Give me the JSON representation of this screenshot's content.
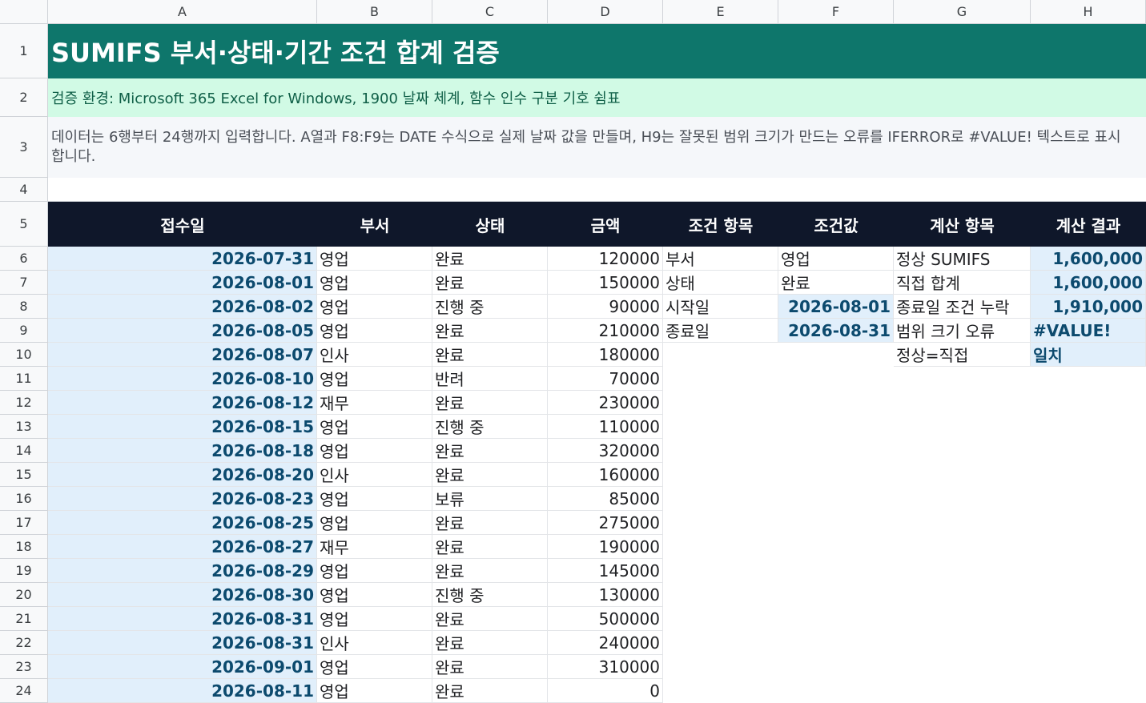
{
  "columns": [
    "A",
    "B",
    "C",
    "D",
    "E",
    "F",
    "G",
    "H"
  ],
  "rows": [
    "1",
    "2",
    "3",
    "4",
    "5",
    "6",
    "7",
    "8",
    "9",
    "10",
    "11",
    "12",
    "13",
    "14",
    "15",
    "16",
    "17",
    "18",
    "19",
    "20",
    "21",
    "22",
    "23",
    "24"
  ],
  "title": "SUMIFS 부서·상태·기간 조건 합계 검증",
  "environment": "검증 환경: Microsoft 365 Excel for Windows, 1900 날짜 체계, 함수 인수 구분 기호 쉼표",
  "description": "데이터는 6행부터 24행까지 입력합니다. A열과 F8:F9는 DATE 수식으로 실제 날짜 값을 만들며, H9는 잘못된 범위 크기가 만드는 오류를 IFERROR로 #VALUE! 텍스트로 표시합니다.",
  "headers": {
    "a": "접수일",
    "b": "부서",
    "c": "상태",
    "d": "금액",
    "e": "조건 항목",
    "f": "조건값",
    "g": "계산 항목",
    "h": "계산 결과"
  },
  "data_rows": [
    {
      "date": "2026-07-31",
      "dept": "영업",
      "status": "완료",
      "amount": "120000"
    },
    {
      "date": "2026-08-01",
      "dept": "영업",
      "status": "완료",
      "amount": "150000"
    },
    {
      "date": "2026-08-02",
      "dept": "영업",
      "status": "진행 중",
      "amount": "90000"
    },
    {
      "date": "2026-08-05",
      "dept": "영업",
      "status": "완료",
      "amount": "210000"
    },
    {
      "date": "2026-08-07",
      "dept": "인사",
      "status": "완료",
      "amount": "180000"
    },
    {
      "date": "2026-08-10",
      "dept": "영업",
      "status": "반려",
      "amount": "70000"
    },
    {
      "date": "2026-08-12",
      "dept": "재무",
      "status": "완료",
      "amount": "230000"
    },
    {
      "date": "2026-08-15",
      "dept": "영업",
      "status": "진행 중",
      "amount": "110000"
    },
    {
      "date": "2026-08-18",
      "dept": "영업",
      "status": "완료",
      "amount": "320000"
    },
    {
      "date": "2026-08-20",
      "dept": "인사",
      "status": "완료",
      "amount": "160000"
    },
    {
      "date": "2026-08-23",
      "dept": "영업",
      "status": "보류",
      "amount": "85000"
    },
    {
      "date": "2026-08-25",
      "dept": "영업",
      "status": "완료",
      "amount": "275000"
    },
    {
      "date": "2026-08-27",
      "dept": "재무",
      "status": "완료",
      "amount": "190000"
    },
    {
      "date": "2026-08-29",
      "dept": "영업",
      "status": "완료",
      "amount": "145000"
    },
    {
      "date": "2026-08-30",
      "dept": "영업",
      "status": "진행 중",
      "amount": "130000"
    },
    {
      "date": "2026-08-31",
      "dept": "영업",
      "status": "완료",
      "amount": "500000"
    },
    {
      "date": "2026-08-31",
      "dept": "인사",
      "status": "완료",
      "amount": "240000"
    },
    {
      "date": "2026-09-01",
      "dept": "영업",
      "status": "완료",
      "amount": "310000"
    },
    {
      "date": "2026-08-11",
      "dept": "영업",
      "status": "완료",
      "amount": "0"
    }
  ],
  "criteria": [
    {
      "label": "부서",
      "value": "영업"
    },
    {
      "label": "상태",
      "value": "완료"
    },
    {
      "label": "시작일",
      "value": "2026-08-01"
    },
    {
      "label": "종료일",
      "value": "2026-08-31"
    }
  ],
  "results": [
    {
      "label": "정상 SUMIFS",
      "value": "1,600,000"
    },
    {
      "label": "직접 합계",
      "value": "1,600,000"
    },
    {
      "label": "종료일 조건 누락",
      "value": "1,910,000"
    },
    {
      "label": "범위 크기 오류",
      "value": "#VALUE!"
    },
    {
      "label": "정상=직접",
      "value": "일치"
    }
  ],
  "colors": {
    "title_bg": "#0e766b",
    "env_bg": "#d1fae5",
    "header_bg": "#0f172a",
    "date_bg": "#e1effb",
    "accent_text": "#0c4a6e"
  }
}
